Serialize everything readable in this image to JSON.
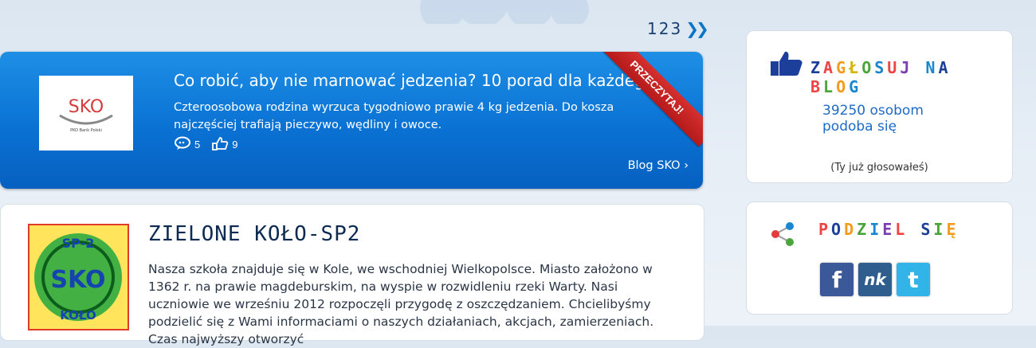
{
  "pagination": {
    "pages": [
      "1",
      "2",
      "3"
    ],
    "next_label": "»"
  },
  "featured": {
    "title": "Co robić, aby nie marnować jedzenia? 10 porad dla każdego",
    "description": "Czteroosobowa rodzina wyrzuca tygodniowo prawie 4 kg jedzenia. Do kosza najczęściej trafiają pieczywo, wędliny i owoce.",
    "comments_count": "5",
    "likes_count": "9",
    "ribbon_label": "PRZECZYTAJ!",
    "readmore_label": "Blog SKO",
    "logo_text": "SKO",
    "logo_subtext": "PKO Bank Polski",
    "colors": {
      "card_blue": "#0a72d4",
      "ribbon_red": "#c42222"
    }
  },
  "post": {
    "heading": "ZIELONE KOŁO-SP2",
    "body": "Nasza szkoła znajduje się w Kole, we wschodniej Wielkopolsce. Miasto założono w 1362 r. na prawie magdeburskim, na wyspie w rozwidleniu rzeki Warty. Nasi uczniowie we wrześniu 2012 rozpoczęli przygodę z oszczędzaniem. Chcielibyśmy podzielić się z Wami informaciami o naszych działaniach, akcjach, zamierzeniach. Czas najwyższy otworzyć",
    "badge_top": "SP-2",
    "badge_mid": "SKO",
    "badge_bottom": "KOŁO"
  },
  "vote_panel": {
    "title": "ZAGŁOSUJ NA BLOG",
    "count_line1": "39250 osobom",
    "count_line2": "podoba się",
    "voted_note": "(Ty już głosowałeś)",
    "icon": "thumbs-up-icon"
  },
  "share_panel": {
    "title": "PODZIEL SIĘ",
    "icon": "share-icon",
    "buttons": [
      {
        "label": "f",
        "icon": "facebook-icon",
        "color": "#3b5998"
      },
      {
        "label": "nk",
        "icon": "nk-icon",
        "color": "#2f5d8e"
      },
      {
        "label": "t",
        "icon": "twitter-icon",
        "color": "#33b4e8"
      }
    ]
  }
}
